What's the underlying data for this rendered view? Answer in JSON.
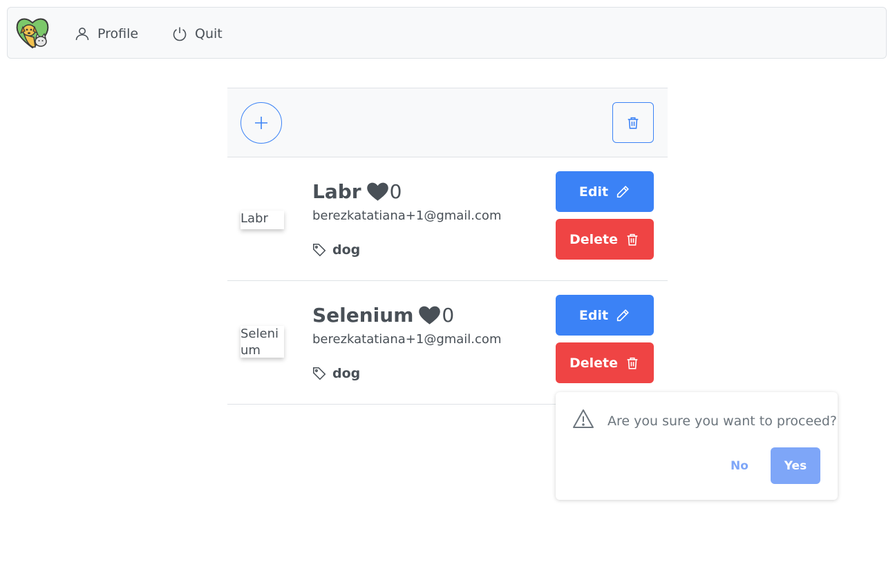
{
  "menubar": {
    "logo_icon": "dog-cat-logo-icon",
    "items": [
      {
        "label": "Profile",
        "icon": "user-icon"
      },
      {
        "label": "Quit",
        "icon": "power-icon"
      }
    ]
  },
  "toolbar": {
    "add_icon": "plus-icon",
    "delete_icon": "trash-icon"
  },
  "pets": [
    {
      "name": "Labr",
      "likes": "0",
      "email": "berezkatatiana+1@gmail.com",
      "tag": "dog",
      "image_alt": "Labr",
      "edit_label": "Edit",
      "delete_label": "Delete"
    },
    {
      "name": "Selenium",
      "likes": "0",
      "email": "berezkatatiana+1@gmail.com",
      "tag": "dog",
      "image_alt": "Selenium",
      "edit_label": "Edit",
      "delete_label": "Delete"
    }
  ],
  "confirm": {
    "message": "Are you sure you want to proceed?",
    "no_label": "No",
    "yes_label": "Yes"
  },
  "colors": {
    "primary": "#3b82f6",
    "danger": "#ef4444",
    "text": "#495057",
    "toolbar_bg": "#f8f9fa"
  }
}
